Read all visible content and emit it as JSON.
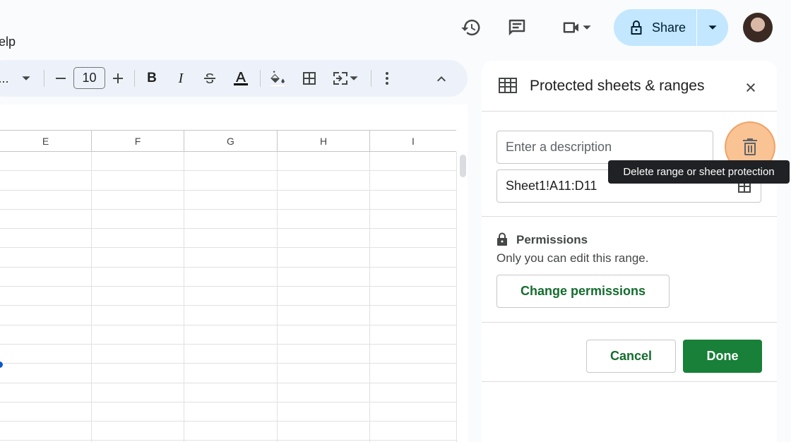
{
  "menu": {
    "help_partial": "elp"
  },
  "topbar": {
    "share_label": "Share",
    "icons": [
      "history-icon",
      "comment-icon",
      "video-call-icon",
      "lock-icon",
      "avatar"
    ]
  },
  "toolbar": {
    "font_more": "...",
    "font_size": "10",
    "icons": [
      "minus-icon",
      "plus-icon",
      "bold-icon",
      "italic-icon",
      "strikethrough-icon",
      "text-color-icon",
      "fill-color-icon",
      "borders-icon",
      "merge-cells-icon",
      "more-vert-icon",
      "chevron-up-icon"
    ]
  },
  "grid": {
    "columns": [
      "E",
      "F",
      "G",
      "H",
      "I"
    ]
  },
  "panel": {
    "title": "Protected sheets & ranges",
    "description_placeholder": "Enter a description",
    "range_value": "Sheet1!A11:D11",
    "tooltip": "Delete range or sheet protection",
    "permissions_title": "Permissions",
    "permissions_desc": "Only you can edit this range.",
    "change_permissions_label": "Change permissions",
    "cancel_label": "Cancel",
    "done_label": "Done"
  },
  "colors": {
    "share_bg": "#c2e7ff",
    "toolbar_bg": "#edf2fa",
    "done_bg": "#188038",
    "green_text": "#146c2e",
    "highlight": "#f7af70"
  }
}
